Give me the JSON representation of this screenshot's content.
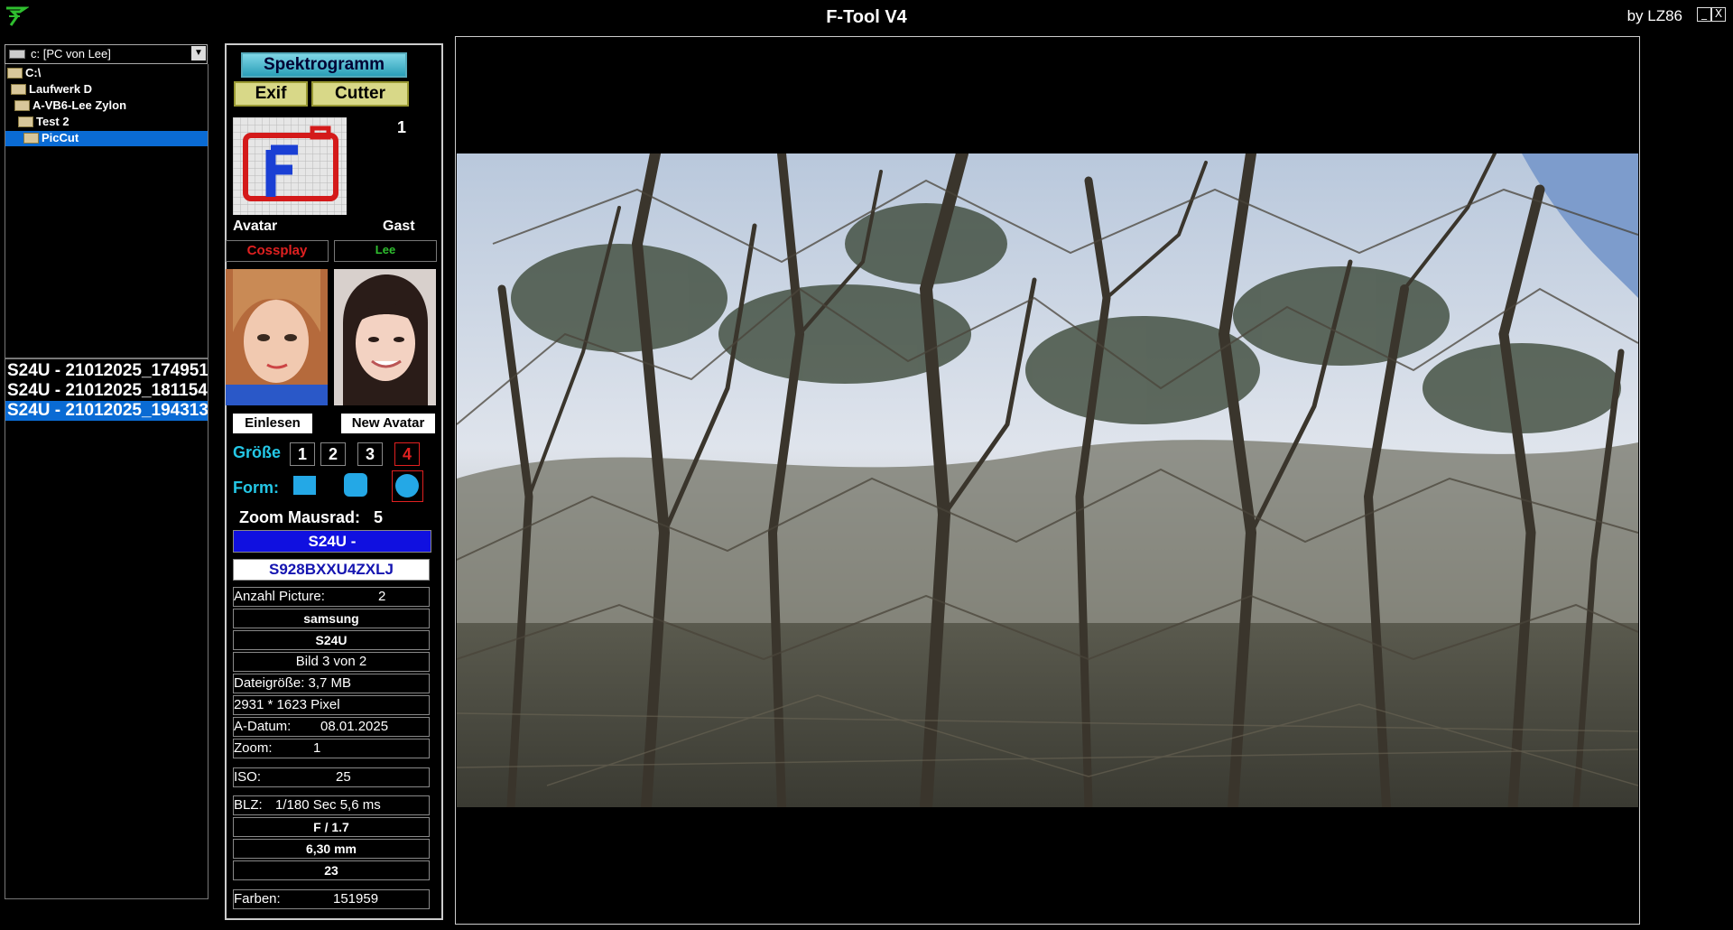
{
  "window": {
    "title": "F-Tool V4",
    "credit": "by LZ86",
    "minimize": "_",
    "close": "X"
  },
  "explorer": {
    "drive": "c: [PC von Lee]",
    "tree": [
      {
        "label": "C:\\",
        "indent": 0,
        "selected": false
      },
      {
        "label": "Laufwerk D",
        "indent": 1,
        "selected": false
      },
      {
        "label": "A-VB6-Lee Zylon",
        "indent": 2,
        "selected": false
      },
      {
        "label": "Test 2",
        "indent": 3,
        "selected": false
      },
      {
        "label": "PicCut",
        "indent": 4,
        "selected": true
      }
    ],
    "files": [
      {
        "label": "S24U - 21012025_174951",
        "selected": false
      },
      {
        "label": "S24U - 21012025_181154",
        "selected": false
      },
      {
        "label": "S24U - 21012025_194313",
        "selected": true
      }
    ]
  },
  "panel": {
    "spektrogramm": "Spektrogramm",
    "exif": "Exif",
    "cutter": "Cutter",
    "counter": "1",
    "avatar_label": "Avatar",
    "gast_label": "Gast",
    "name_left": "Cossplay",
    "name_right": "Lee",
    "einlesen": "Einlesen",
    "new_avatar": "New Avatar",
    "groesse_label": "Größe",
    "sizes": [
      "1",
      "2",
      "3",
      "4"
    ],
    "selected_size": "4",
    "form_label": "Form:",
    "zoom_label": "Zoom Mausrad:",
    "zoom_value": "5",
    "model": "S24U -",
    "firmware": "S928BXXU4ZXLJ",
    "anzahl_label": "Anzahl Picture:",
    "anzahl_value": "2",
    "make": "samsung",
    "model_short": "S24U",
    "bild": "Bild  3 von 2",
    "dateigroesse": "Dateigröße: 3,7 MB",
    "pixel": "2931 * 1623 Pixel",
    "datum_label": "A-Datum:",
    "datum_value": "08.01.2025",
    "zoom_row_label": "Zoom:",
    "zoom_row_value": "1",
    "iso_label": "ISO:",
    "iso_value": "25",
    "blz_label": "BLZ:",
    "blz_value": "1/180 Sec    5,6 ms",
    "fnumber": "F / 1.7",
    "focal": "6,30 mm",
    "focal35": "23",
    "farben_label": "Farben:",
    "farben_value": "151959"
  },
  "colors": {
    "accent_cyan": "#24c7e6",
    "selection_blue": "#0a6bd4",
    "red": "#e02020",
    "green": "#2fbf2f"
  }
}
